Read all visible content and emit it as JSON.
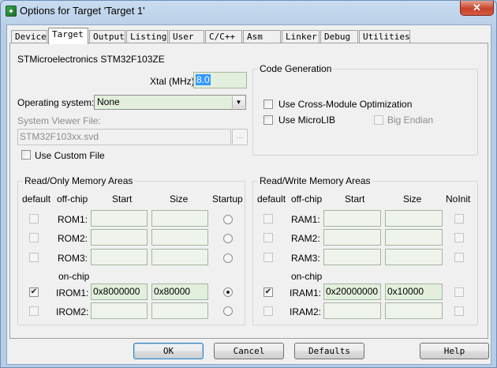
{
  "window": {
    "title": "Options for Target 'Target 1'",
    "close_glyph": "✕"
  },
  "tabs": [
    "Device",
    "Target",
    "Output",
    "Listing",
    "User",
    "C/C++",
    "Asm",
    "Linker",
    "Debug",
    "Utilities"
  ],
  "device_name": "STMicroelectronics STM32F103ZE",
  "xtal": {
    "label": "Xtal (MHz):",
    "value": "8.0"
  },
  "os": {
    "label": "Operating system:",
    "value": "None"
  },
  "svf": {
    "label": "System Viewer File:",
    "value": "STM32F103xx.svd",
    "browse_label": "..."
  },
  "use_custom_file": {
    "label": "Use Custom File",
    "checked": false
  },
  "code_gen": {
    "title": "Code Generation",
    "cross_module": {
      "label": "Use Cross-Module Optimization",
      "checked": false
    },
    "microlib": {
      "label": "Use MicroLIB",
      "checked": false
    },
    "big_endian": {
      "label": "Big Endian",
      "checked": false
    }
  },
  "rom": {
    "title": "Read/Only Memory Areas",
    "headers": {
      "default": "default",
      "offchip": "off-chip",
      "start": "Start",
      "size": "Size",
      "flag": "Startup"
    },
    "onchip_label": "on-chip",
    "rows": [
      {
        "name": "ROM1:",
        "start": "",
        "size": "",
        "default": false,
        "flag": false
      },
      {
        "name": "ROM2:",
        "start": "",
        "size": "",
        "default": false,
        "flag": false
      },
      {
        "name": "ROM3:",
        "start": "",
        "size": "",
        "default": false,
        "flag": false
      },
      {
        "name": "IROM1:",
        "start": "0x8000000",
        "size": "0x80000",
        "default": true,
        "flag": true
      },
      {
        "name": "IROM2:",
        "start": "",
        "size": "",
        "default": false,
        "flag": false
      }
    ]
  },
  "ram": {
    "title": "Read/Write Memory Areas",
    "headers": {
      "default": "default",
      "offchip": "off-chip",
      "start": "Start",
      "size": "Size",
      "flag": "NoInit"
    },
    "onchip_label": "on-chip",
    "rows": [
      {
        "name": "RAM1:",
        "start": "",
        "size": "",
        "default": false,
        "flag": false
      },
      {
        "name": "RAM2:",
        "start": "",
        "size": "",
        "default": false,
        "flag": false
      },
      {
        "name": "RAM3:",
        "start": "",
        "size": "",
        "default": false,
        "flag": false
      },
      {
        "name": "IRAM1:",
        "start": "0x20000000",
        "size": "0x10000",
        "default": true,
        "flag": false
      },
      {
        "name": "IRAM2:",
        "start": "",
        "size": "",
        "default": false,
        "flag": false
      }
    ]
  },
  "buttons": {
    "ok": "OK",
    "cancel": "Cancel",
    "defaults": "Defaults",
    "help": "Help"
  },
  "checkmark_glyph": "✔",
  "dropdown_glyph": "▼"
}
